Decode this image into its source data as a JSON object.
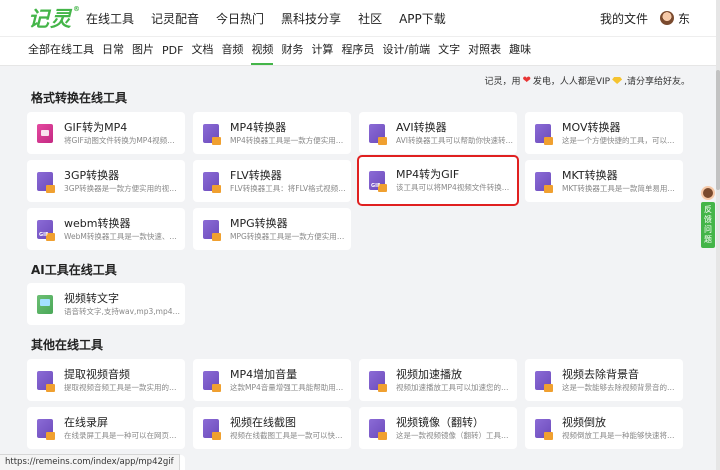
{
  "header": {
    "logo": "记灵",
    "logo_mark": "®",
    "nav": [
      "在线工具",
      "记灵配音",
      "今日热门",
      "黑科技分享",
      "社区",
      "APP下载"
    ],
    "my_files": "我的文件",
    "user_name": "东"
  },
  "categories": {
    "items": [
      "全部在线工具",
      "日常",
      "图片",
      "PDF",
      "文档",
      "音频",
      "视频",
      "财务",
      "计算",
      "程序员",
      "设计/前端",
      "文字",
      "对照表",
      "趣味"
    ],
    "active": "视频"
  },
  "notice": {
    "part1": "记灵，用",
    "part2": "发电，人人都是VIP",
    "part3": ",请分享给好友。"
  },
  "sections": {
    "format": {
      "title": "格式转换在线工具"
    },
    "ai": {
      "title": "AI工具在线工具"
    },
    "other": {
      "title": "其他在线工具"
    }
  },
  "format_tools": [
    {
      "name": "GIF转为MP4",
      "desc": "将GIF动图文件转换为MP4视频文件...",
      "icon": "gif-to-mp4-icon"
    },
    {
      "name": "MP4转换器",
      "desc": "MP4转换器工具是一款方便实用的工...",
      "icon": "mp4-converter-icon"
    },
    {
      "name": "AVI转换器",
      "desc": "AVI转换器工具可以帮助你快速转换...",
      "icon": "avi-converter-icon"
    },
    {
      "name": "MOV转换器",
      "desc": "这是一个方便快捷的工具，可以将各...",
      "icon": "mov-converter-icon"
    },
    {
      "name": "3GP转换器",
      "desc": "3GP转换器是一款方便实用的视频格...",
      "icon": "3gp-converter-icon"
    },
    {
      "name": "FLV转换器",
      "desc": "FLV转换器工具：将FLV格式视频转换...",
      "icon": "flv-converter-icon"
    },
    {
      "name": "MP4转为GIF",
      "desc": "该工具可以将MP4视频文件转换为GI...",
      "icon": "mp4-to-gif-icon"
    },
    {
      "name": "MKT转换器",
      "desc": "MKT转换器工具是一款简单易用的实...",
      "icon": "mkt-converter-icon"
    },
    {
      "name": "webm转换器",
      "desc": "WebM转换器工具是一款快速、简便...",
      "icon": "webm-converter-icon"
    },
    {
      "name": "MPG转换器",
      "desc": "MPG转换器工具是一款方便实用的工...",
      "icon": "mpg-converter-icon"
    }
  ],
  "ai_tools": [
    {
      "name": "视频转文字",
      "desc": "语音转文字,支持wav,mp3,mp4,mov...",
      "icon": "video-to-text-icon"
    }
  ],
  "other_tools": [
    {
      "name": "提取视频音频",
      "desc": "提取视频音频工具是一款实用的软件...",
      "icon": "extract-audio-icon"
    },
    {
      "name": "MP4增加音量",
      "desc": "这款MP4音量增强工具能帮助用户快...",
      "icon": "mp4-volume-icon"
    },
    {
      "name": "视频加速播放",
      "desc": "视频加速播放工具可以加速您的视频...",
      "icon": "video-speed-icon"
    },
    {
      "name": "视频去除背景音",
      "desc": "这是一款能够去除视频背景音的工具。",
      "icon": "remove-bg-audio-icon"
    },
    {
      "name": "在线录屏",
      "desc": "在线录屏工具是一种可以在网页上进...",
      "icon": "screen-record-icon"
    },
    {
      "name": "视频在线截图",
      "desc": "视频在线截图工具是一款可以快速提...",
      "icon": "video-screenshot-icon"
    },
    {
      "name": "视频镜像（翻转）",
      "desc": "这是一款视频镜像（翻转）工具，可...",
      "icon": "video-mirror-icon"
    },
    {
      "name": "视频倒放",
      "desc": "视频倒放工具是一种能够快速将视频...",
      "icon": "video-reverse-icon"
    }
  ],
  "feedback": {
    "label": "反馈问题"
  },
  "status_url": "https://remeins.com/index/app/mp42gif",
  "colors": {
    "brand": "#44b549",
    "highlight": "#e02020"
  }
}
